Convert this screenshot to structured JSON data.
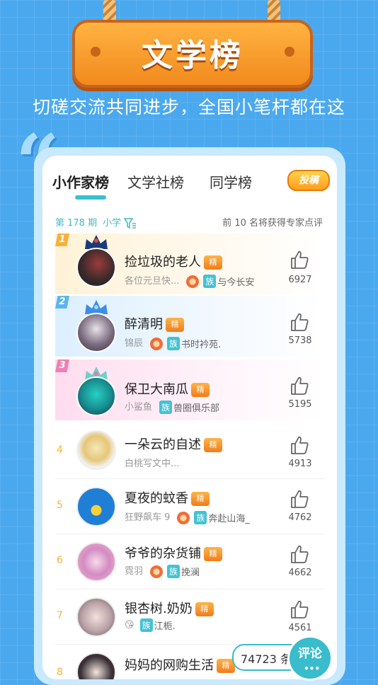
{
  "header": {
    "title": "文学榜",
    "slogan": "切磋交流共同进步，全国小笔杆都在这"
  },
  "tabs": [
    {
      "label": "小作家榜",
      "active": true
    },
    {
      "label": "文学社榜",
      "active": false
    },
    {
      "label": "同学榜",
      "active": false
    }
  ],
  "submit_label": "投稿",
  "filter": {
    "period": "第 178 期",
    "grade": "小学"
  },
  "tip": "前 10 名将获得专家点评",
  "ranking": [
    {
      "rank": "1",
      "title": "捡垃圾的老人",
      "author": "各位元旦快...",
      "has_medal": true,
      "clan": "族",
      "clan_name": "与今长安",
      "likes": "6927"
    },
    {
      "rank": "2",
      "title": "醉清明",
      "author": "锦辰",
      "has_medal": true,
      "clan": "族",
      "clan_name": "书时衿苑.",
      "likes": "5738"
    },
    {
      "rank": "3",
      "title": "保卫大南瓜",
      "author": "小鲨鱼",
      "has_medal": false,
      "clan": "族",
      "clan_name": "兽圈俱乐部",
      "likes": "5195"
    },
    {
      "rank": "4",
      "title": "一朵云的自述",
      "author": "白桃写文中...",
      "has_medal": false,
      "clan": "",
      "clan_name": "",
      "likes": "4913"
    },
    {
      "rank": "5",
      "title": "夏夜的蚊香",
      "author": "狂野飙车 9",
      "has_medal": true,
      "clan": "族",
      "clan_name": "奔赴山海_",
      "likes": "4762"
    },
    {
      "rank": "6",
      "title": "爷爷的杂货铺",
      "author": "霓羽",
      "has_medal": true,
      "clan": "族",
      "clan_name": "挽澜",
      "likes": "4662"
    },
    {
      "rank": "7",
      "title": "银杏树.奶奶",
      "author": "😘",
      "has_medal": false,
      "clan": "族",
      "clan_name": "江栀.",
      "likes": "4561"
    },
    {
      "rank": "8",
      "title": "妈妈的网购生活",
      "author": "",
      "has_medal": false,
      "clan": "",
      "clan_name": "",
      "likes": ""
    }
  ],
  "jing_label": "精",
  "comments": {
    "count": "74723 条",
    "button": "评论"
  },
  "colors": {
    "accent": "#36c2cf",
    "background": "#4aa8ee",
    "sign": "#f28a1d",
    "rank_gold": "#f3b53b"
  }
}
